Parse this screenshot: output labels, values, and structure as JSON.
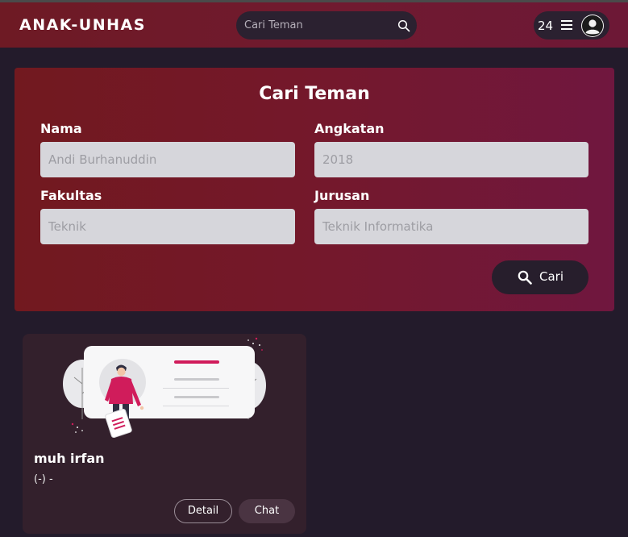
{
  "navbar": {
    "brand": "ANAK-UNHAS",
    "search_placeholder": "Cari Teman",
    "count": "24"
  },
  "form": {
    "title": "Cari Teman",
    "nama_label": "Nama",
    "nama_placeholder": "Andi Burhanuddin",
    "angkatan_label": "Angkatan",
    "angkatan_placeholder": "2018",
    "fakultas_label": "Fakultas",
    "fakultas_placeholder": "Teknik",
    "jurusan_label": "Jurusan",
    "jurusan_placeholder": "Teknik Informatika",
    "submit_label": "Cari"
  },
  "results": [
    {
      "name": "muh irfan",
      "subtitle": "(-) -",
      "detail_label": "Detail",
      "chat_label": "Chat"
    }
  ],
  "colors": {
    "accent": "#d01c5b",
    "panel": "#72191f",
    "background": "#231b2b"
  }
}
